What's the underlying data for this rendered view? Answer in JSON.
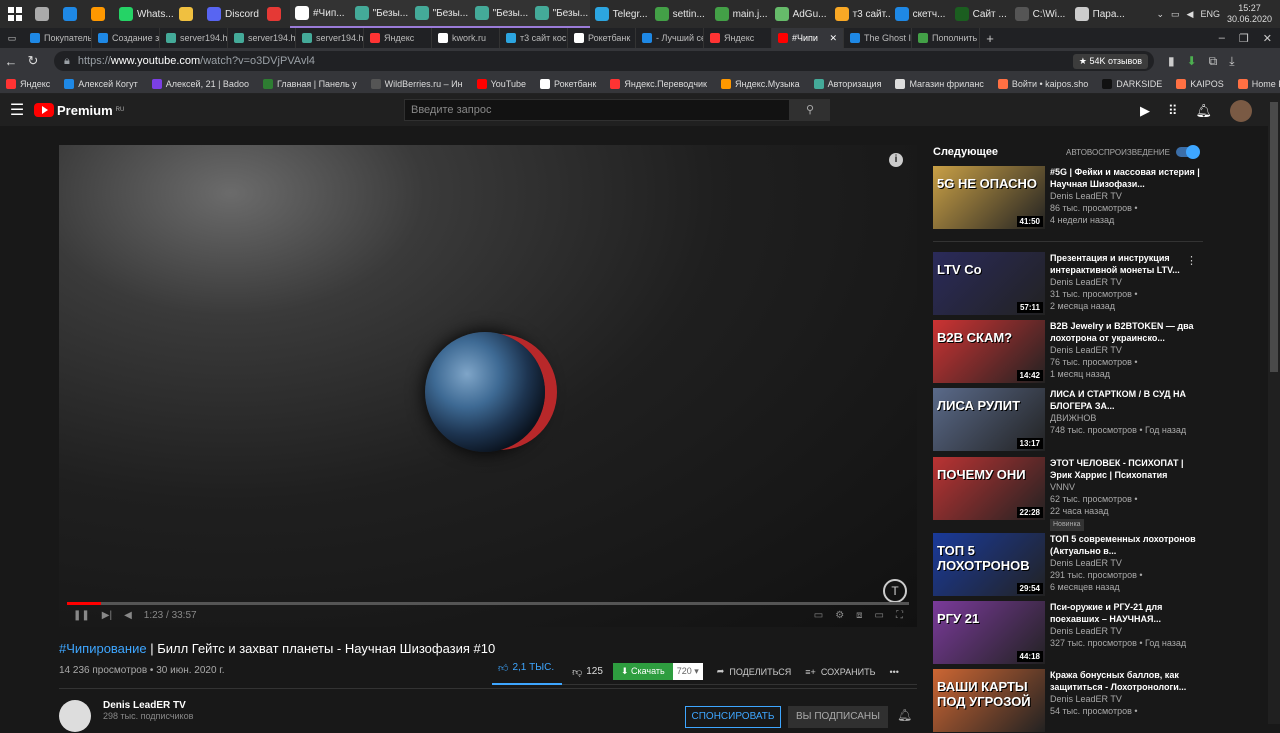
{
  "taskbar": {
    "items": [
      {
        "label": "",
        "color": "#aaa"
      },
      {
        "label": "",
        "color": "#1e88e5"
      },
      {
        "label": "",
        "color": "#ff9800"
      },
      {
        "label": "Whats...",
        "color": "#25d366"
      },
      {
        "label": "",
        "color": "#f0c040"
      },
      {
        "label": "Discord",
        "color": "#5865f2"
      },
      {
        "label": "",
        "color": "#e53935"
      },
      {
        "label": "#Чип...",
        "color": "#fff"
      },
      {
        "label": "\"Безы...",
        "color": "#4a9"
      },
      {
        "label": "\"Безы...",
        "color": "#4a9"
      },
      {
        "label": "\"Безы...",
        "color": "#4a9"
      },
      {
        "label": "\"Безы...",
        "color": "#4a9"
      },
      {
        "label": "Telegr...",
        "color": "#2ca5e0"
      },
      {
        "label": "settin...",
        "color": "#43a047"
      },
      {
        "label": "main.j...",
        "color": "#43a047"
      },
      {
        "label": "AdGu...",
        "color": "#66bb6a"
      },
      {
        "label": "т3 сайт...",
        "color": "#f9a825"
      },
      {
        "label": "скетч...",
        "color": "#1e88e5"
      },
      {
        "label": "Сайт ...",
        "color": "#1b5e20"
      },
      {
        "label": "C:\\Wi...",
        "color": "#555"
      },
      {
        "label": "Пара...",
        "color": "#ccc"
      }
    ],
    "lang": "ENG",
    "time": "15:27",
    "date": "30.06.2020"
  },
  "tabs": [
    {
      "label": "Покупатель",
      "color": "#1e88e5"
    },
    {
      "label": "Создание за",
      "color": "#1e88e5"
    },
    {
      "label": "server194.hc",
      "color": "#4a9"
    },
    {
      "label": "server194.hc",
      "color": "#4a9"
    },
    {
      "label": "server194.hc",
      "color": "#4a9"
    },
    {
      "label": "Яндекс",
      "color": "#f33"
    },
    {
      "label": "kwork.ru",
      "color": "#fff"
    },
    {
      "label": "т3 сайт косм",
      "color": "#2ca5e0"
    },
    {
      "label": "Рокетбанк",
      "color": "#fff"
    },
    {
      "label": "- Лучший се",
      "color": "#1e88e5"
    },
    {
      "label": "Яндекс",
      "color": "#f33"
    },
    {
      "label": "#Чипи",
      "color": "#f00",
      "active": true
    },
    {
      "label": "The Ghost In",
      "color": "#1e88e5"
    },
    {
      "label": "Пополнить",
      "color": "#43a047"
    }
  ],
  "address": {
    "prefix": "https://",
    "domain": "www.youtube.com",
    "path": "/watch?v=o3DVjPVAvl4",
    "reviews": "★ 54K отзывов"
  },
  "bookmarks": [
    {
      "label": "Яндекс",
      "color": "#f33"
    },
    {
      "label": "Алексей Когут",
      "color": "#1e88e5"
    },
    {
      "label": "Алексей, 21 | Badoo",
      "color": "#7b3fe4"
    },
    {
      "label": "Главная | Панель у",
      "color": "#2e7d32"
    },
    {
      "label": "WildBerries.ru – Ин",
      "color": "#555"
    },
    {
      "label": "YouTube",
      "color": "#f00"
    },
    {
      "label": "Рокетбанк",
      "color": "#fff"
    },
    {
      "label": "Яндекс.Переводчик",
      "color": "#f33"
    },
    {
      "label": "Яндекс.Музыка",
      "color": "#ff9800"
    },
    {
      "label": "Авторизация",
      "color": "#4a9"
    },
    {
      "label": "Магазин фриланс",
      "color": "#ddd"
    },
    {
      "label": "Войти • kaipos.sho",
      "color": "#ff7043"
    },
    {
      "label": "DARKSIDE",
      "color": "#111"
    },
    {
      "label": "KAIPOS",
      "color": "#ff7043"
    },
    {
      "label": "Home P",
      "color": "#ff7043"
    }
  ],
  "yt": {
    "logo_text": "Premium",
    "logo_region": "RU",
    "search_placeholder": "Введите запрос"
  },
  "player": {
    "time": "1:23 / 33:57",
    "progress": 0.04
  },
  "video": {
    "title_tag": "#Чипирование",
    "title_rest": " | Билл Гейтс и захват планеты - Научная Шизофазия #10",
    "views": "14 236 просмотров",
    "date": "30 июн. 2020 г.",
    "likes": "2,1 ТЫС.",
    "dislikes": "125",
    "download": "Скачать",
    "quality": "720",
    "share": "ПОДЕЛИТЬСЯ",
    "save": "СОХРАНИТЬ"
  },
  "channel": {
    "name": "Denis LeadER TV",
    "subs": "298 тыс. подписчиков",
    "sponsor": "СПОНСИРОВАТЬ",
    "subscribed": "ВЫ ПОДПИСАНЫ"
  },
  "sidebar": {
    "next_label": "Следующее",
    "autoplay_label": "АВТОВОСПРОИЗВЕДЕНИЕ",
    "items": [
      {
        "title": "#5G | Фейки и массовая истерия | Научная Шизофази...",
        "channel": "Denis LeadER TV",
        "views": "86 тыс. просмотров •",
        "age": "4 недели назад",
        "duration": "41:50",
        "thumb_text": "5G НЕ ОПАСНО",
        "color": "#c9a046"
      },
      {
        "title": "Презентация и инструкция интерактивной монеты LTV...",
        "channel": "Denis LeadER TV",
        "views": "31 тыс. просмотров •",
        "age": "2 месяца назад",
        "duration": "57:11",
        "thumb_text": "LTV Co",
        "color": "#2a2a5a"
      },
      {
        "title": "B2B Jewelry и B2BTOKEN — два лохотрона от украинско...",
        "channel": "Denis LeadER TV",
        "views": "76 тыс. просмотров •",
        "age": "1 месяц назад",
        "duration": "14:42",
        "thumb_text": "B2B СКАМ?",
        "color": "#c33"
      },
      {
        "title": "ЛИСА И СТАРТКОМ / В СУД НА БЛОГЕРА ЗА...",
        "channel": "ДВИЖНОВ",
        "views": "748 тыс. просмотров • Год назад",
        "age": "",
        "duration": "13:17",
        "thumb_text": "ЛИСА РУЛИТ",
        "color": "#5a6a8a"
      },
      {
        "title": "ЭТОТ ЧЕЛОВЕК - ПСИХОПАТ | Эрик Харрис | Психопатия",
        "channel": "VNNV",
        "views": "62 тыс. просмотров •",
        "age": "22 часа назад",
        "duration": "22:28",
        "thumb_text": "ПОЧЕМУ ОНИ",
        "color": "#b33",
        "badge": "Новинка"
      },
      {
        "title": "ТОП 5 современных лохотронов (Актуально в...",
        "channel": "Denis LeadER TV",
        "views": "291 тыс. просмотров •",
        "age": "6 месяцев назад",
        "duration": "29:54",
        "thumb_text": "ТОП 5 ЛОХОТРОНОВ",
        "color": "#1a3a9a"
      },
      {
        "title": "Пси-оружие и РГУ-21 для поехавших – НАУЧНАЯ...",
        "channel": "Denis LeadER TV",
        "views": "327 тыс. просмотров • Год назад",
        "age": "",
        "duration": "44:18",
        "thumb_text": "РГУ 21",
        "color": "#7a3a9a"
      },
      {
        "title": "Кража бонусных баллов, как защититься - Лохотронологи...",
        "channel": "Denis LeadER TV",
        "views": "54 тыс. просмотров •",
        "age": "",
        "duration": "",
        "thumb_text": "ВАШИ КАРТЫ ПОД УГРОЗОЙ",
        "color": "#c63"
      }
    ]
  }
}
